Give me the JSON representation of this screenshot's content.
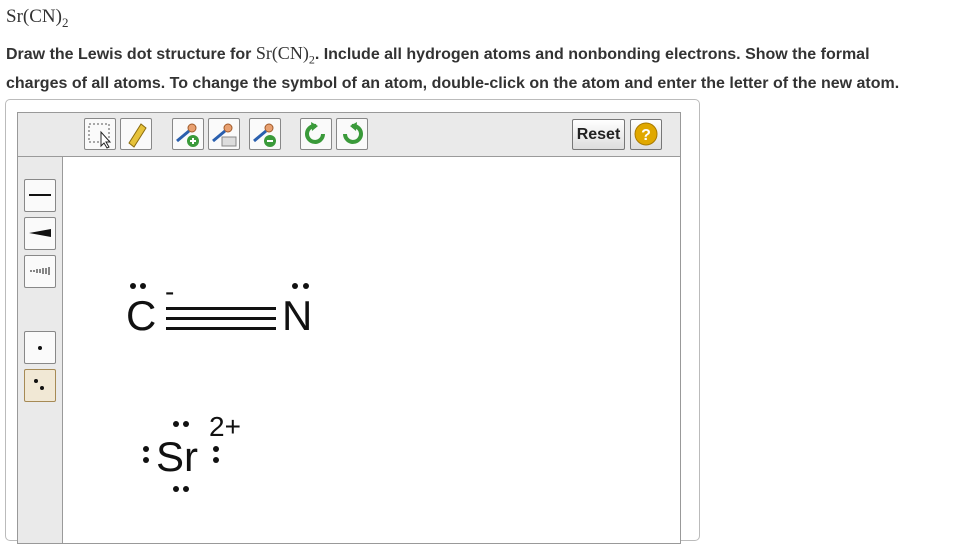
{
  "question": {
    "formula_main": "Sr(CN)",
    "formula_sub": "2",
    "line1_before": "Draw the Lewis dot structure for ",
    "line1_chem": "Sr(CN)",
    "line1_chem_sub": "2",
    "line1_after": ". Include all hydrogen atoms and nonbonding electrons. Show the formal",
    "line2": "charges of all atoms. To change the symbol of an atom, double-click on the atom and enter the letter of the new atom."
  },
  "toolbar": {
    "tools": [
      "select-tool",
      "eraser-tool",
      "add-atom-tool",
      "edit-atom-tool",
      "remove-atom-tool",
      "undo",
      "redo"
    ],
    "reset_label": "Reset",
    "help_label": "?"
  },
  "sidebar": {
    "tools": [
      "single-bond",
      "wedge-bond",
      "hash-bond",
      "single-electron",
      "electron-pair"
    ],
    "selected": "electron-pair"
  },
  "molecule": {
    "carbon_symbol": "C",
    "carbon_charge": "-",
    "nitrogen_symbol": "N",
    "bond": "triple",
    "strontium_symbol": "Sr",
    "strontium_charge": "2+"
  },
  "colors": {
    "toolbar_bg": "#eaeaea",
    "icon_green": "#3a9a3a",
    "help_gold": "#e0a800",
    "selected_tool_bg": "#f1e8d5"
  }
}
